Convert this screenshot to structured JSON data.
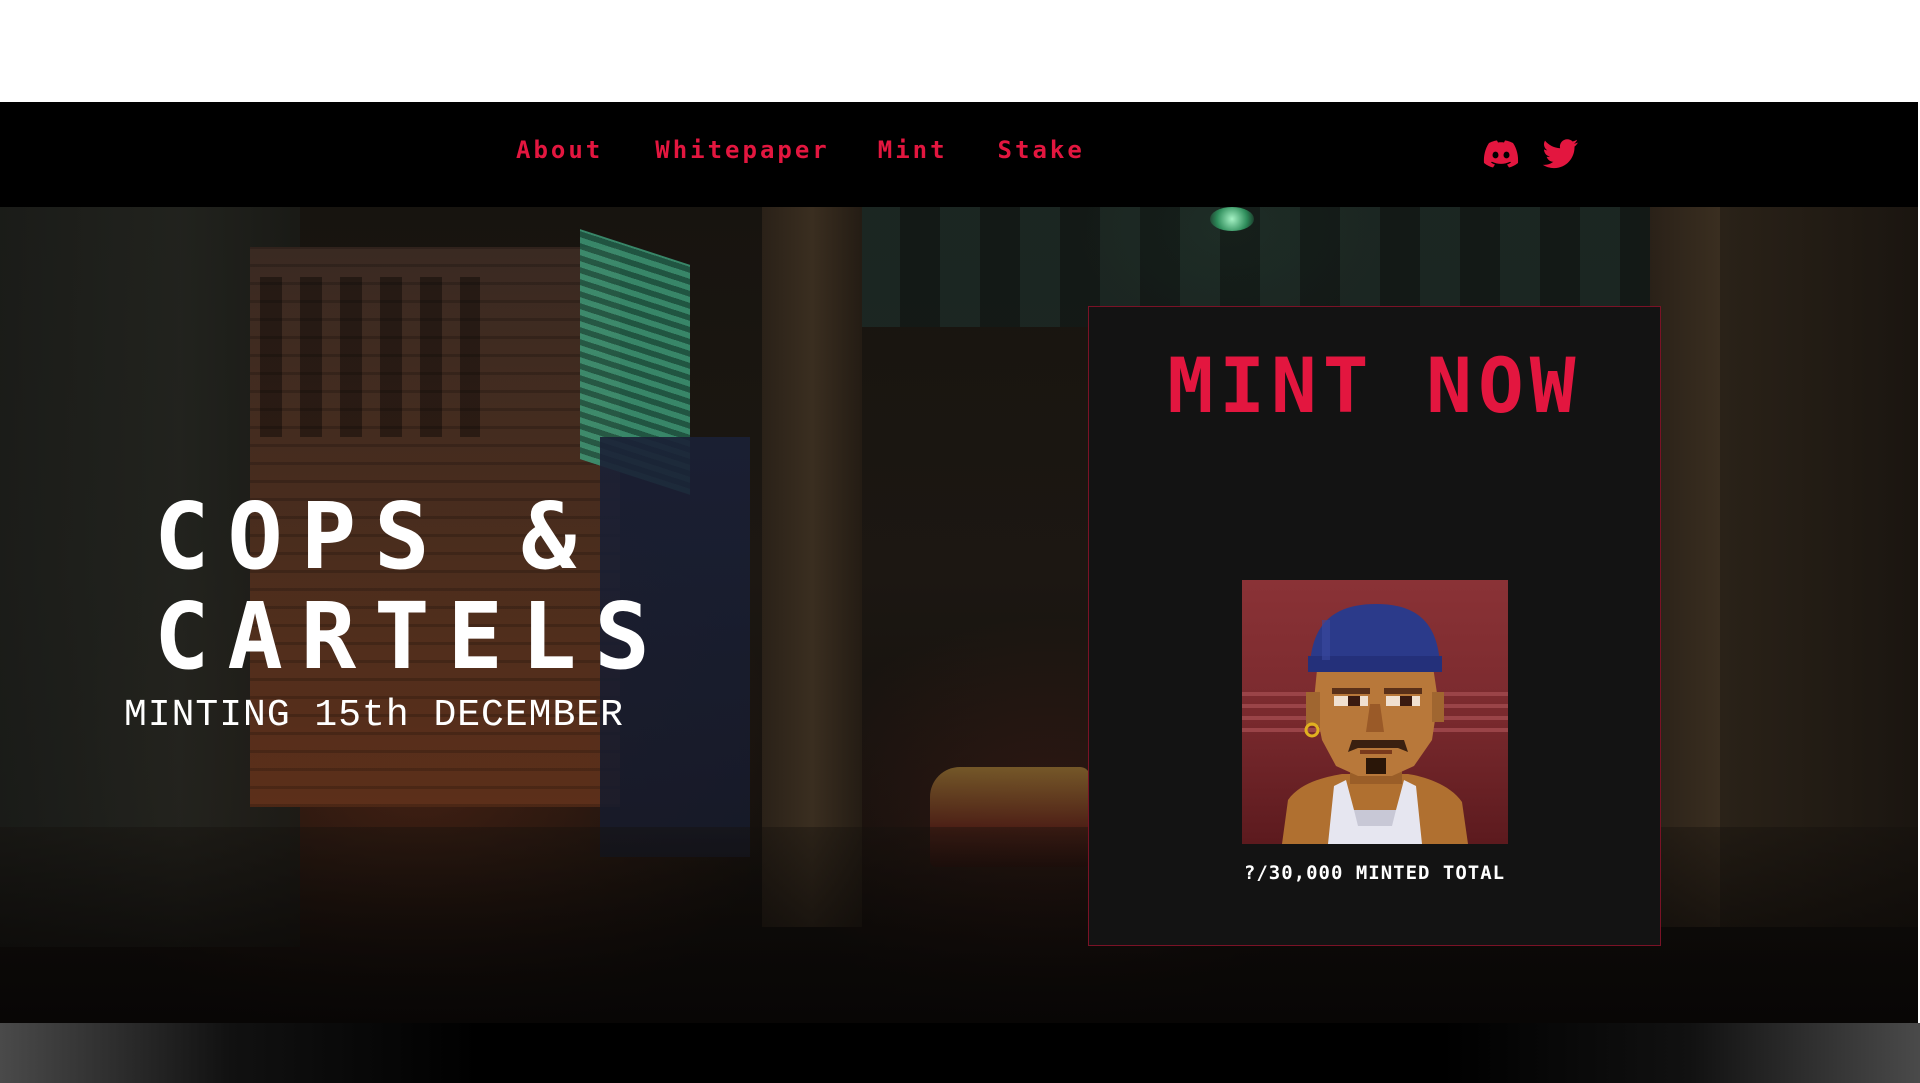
{
  "nav": {
    "links": [
      "About",
      "Whitepaper",
      "Mint",
      "Stake"
    ],
    "accent_color": "#e3163f"
  },
  "social": {
    "icons": [
      "discord-icon",
      "twitter-icon"
    ]
  },
  "hero": {
    "title": "COPS &\nCARTELS",
    "subtitle": "MINTING 15th DECEMBER"
  },
  "mint_card": {
    "title": "MINT NOW",
    "minted_total": "?/30,000 MINTED TOTAL",
    "image": "character-avatar"
  },
  "colors": {
    "accent": "#e3163f",
    "card_bg": "#131313",
    "nav_bg": "#000000"
  }
}
